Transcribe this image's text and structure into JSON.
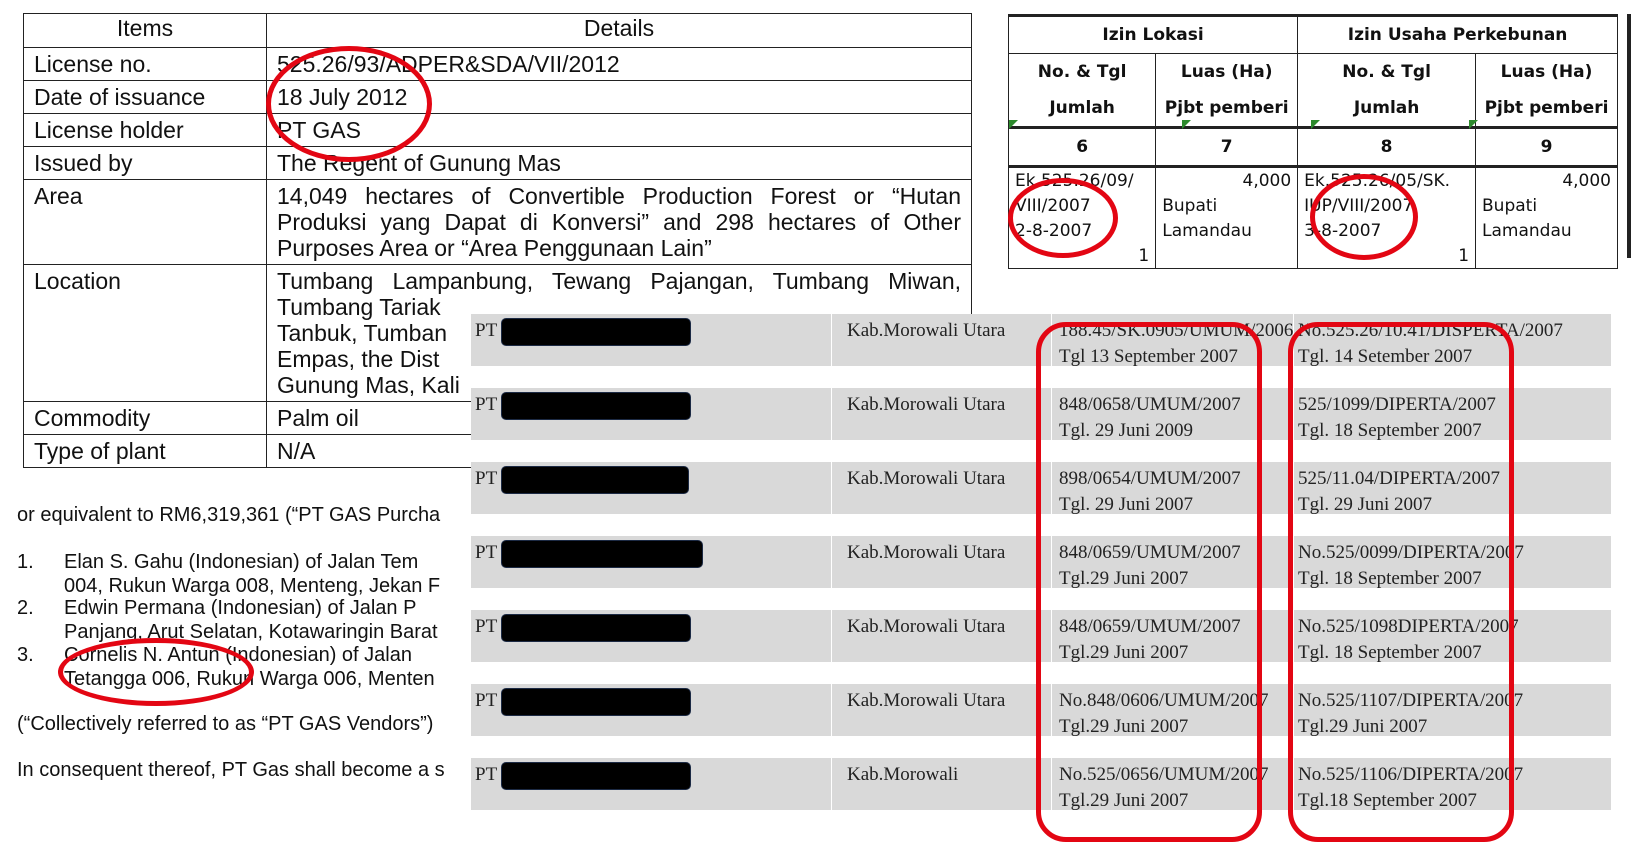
{
  "license_table": {
    "header": {
      "items": "Items",
      "details": "Details"
    },
    "rows": [
      {
        "label": "License no.",
        "value": "525.26/93/ADPER&SDA/VII/2012"
      },
      {
        "label": "Date of issuance",
        "value": "18 July 2012"
      },
      {
        "label": "License holder",
        "value": "PT GAS"
      },
      {
        "label": "Issued by",
        "value": "The Regent of Gunung Mas"
      },
      {
        "label": "Area",
        "lines": [
          "14,049 hectares of Convertible Production Forest or “Hutan",
          "Produksi yang Dapat di Konversi” and 298 hectares of Other",
          "Purposes Area or “Area Penggunaan Lain”"
        ]
      },
      {
        "label": "Location",
        "lines": [
          "Tumbang Lampanbung, Tewang Pajangan, Tumbang Miwan,",
          "Tumbang Tariak",
          "Tanbuk, Tumban",
          "Empas, the Dist",
          "Gunung Mas, Kali"
        ]
      },
      {
        "label": "Commodity",
        "value": "Palm oil"
      },
      {
        "label": "Type of plant",
        "value": "N/A"
      }
    ]
  },
  "vendors_text": {
    "intro": "or equivalent to RM6,319,361 (“PT GAS Purcha",
    "items": [
      {
        "num": "1.",
        "line1": "Elan S. Gahu (Indonesian) of Jalan Tem",
        "line2": "004, Rukun Warga 008, Menteng, Jekan F"
      },
      {
        "num": "2.",
        "line1": "Edwin Permana (Indonesian) of Jalan P",
        "line2": "Panjang, Arut Selatan, Kotawaringin Barat"
      },
      {
        "num": "3.",
        "line1": "Cornelis N. Antun (Indonesian) of Jalan",
        "line2": "Tetangga 006, Rukun Warga 006, Menten"
      }
    ],
    "collective": "(“Collectively referred to as “PT GAS Vendors”)",
    "consequent": "In consequent thereof, PT Gas shall become a s"
  },
  "izin_table": {
    "group1": "Izin Lokasi",
    "group2": "Izin Usaha Perkebunan",
    "sub1": [
      "No. & Tgl",
      "Luas (Ha)",
      "No. & Tgl",
      "Luas (Ha)"
    ],
    "sub2": [
      "Jumlah",
      "Pjbt pemberi",
      "Jumlah",
      "Pjbt pemberi"
    ],
    "nums": [
      "6",
      "7",
      "8",
      "9"
    ],
    "data": [
      [
        "Ek.525.26/09/",
        "4,000",
        "Ek.525.26/05/SK.",
        "4,000"
      ],
      [
        "VIII/2007",
        "Bupati",
        "IUP/VIII/2007",
        "Bupati"
      ],
      [
        "2-8-2007",
        "Lamandau",
        "3-8-2007",
        "Lamandau"
      ],
      [
        "1",
        "",
        "1",
        ""
      ]
    ]
  },
  "morowali": {
    "rows": [
      {
        "pt": "PT",
        "loc": "Kab.Morowali Utara",
        "lok_no": "188.45/SK.0905/UMUM/2006",
        "lok_date": "Tgl 13 September 2007",
        "iup_no": "No.525.26/10.41/DISPERTA/2007",
        "iup_date": "Tgl. 14 Setember 2007"
      },
      {
        "pt": "PT",
        "loc": "Kab.Morowali Utara",
        "lok_no": "848/0658/UMUM/2007",
        "lok_date": "Tgl. 29 Juni 2009",
        "iup_no": "525/1099/DIPERTA/2007",
        "iup_date": "Tgl. 18 September 2007"
      },
      {
        "pt": "PT",
        "loc": "Kab.Morowali Utara",
        "lok_no": "898/0654/UMUM/2007",
        "lok_date": "Tgl. 29 Juni 2007",
        "iup_no": "525/11.04/DIPERTA/2007",
        "iup_date": "Tgl. 29 Juni 2007"
      },
      {
        "pt": "PT",
        "loc": "Kab.Morowali Utara",
        "lok_no": "848/0659/UMUM/2007",
        "lok_date": "Tgl.29 Juni 2007",
        "iup_no": "No.525/0099/DIPERTA/2007",
        "iup_date": "Tgl. 18 September 2007"
      },
      {
        "pt": "PT",
        "loc": "Kab.Morowali Utara",
        "lok_no": "848/0659/UMUM/2007",
        "lok_date": "Tgl.29 Juni 2007",
        "iup_no": "No.525/1098DIPERTA/2007",
        "iup_date": "Tgl. 18 September 2007"
      },
      {
        "pt": "PT",
        "loc": "Kab.Morowali Utara",
        "lok_no": "No.848/0606/UMUM/2007",
        "lok_date": "Tgl.29 Juni 2007",
        "iup_no": "No.525/1107/DIPERTA/2007",
        "iup_date": "Tgl.29 Juni 2007"
      },
      {
        "pt": "PT",
        "loc": "Kab.Morowali",
        "lok_no": "No.525/0656/UMUM/2007",
        "lok_date": "Tgl.29 Juni 2007",
        "iup_no": "No.525/1106/DIPERTA/2007",
        "iup_date": "Tgl.18 September 2007"
      }
    ]
  },
  "colors": {
    "annotation": "#e30613",
    "band": "#d9d9d9",
    "marker": "#2d8a2d"
  }
}
